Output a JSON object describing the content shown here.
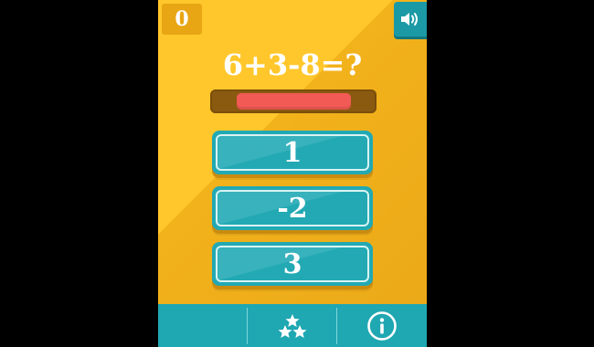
{
  "game": {
    "score": "0",
    "question": "6+3-8=?",
    "timer_remaining": 0.72,
    "answers": [
      "1",
      "-2",
      "3"
    ]
  },
  "icons": {
    "sound": "speaker-on-icon",
    "rate": "stars-icon",
    "info": "info-icon"
  },
  "colors": {
    "background": "#f2b21b",
    "button": "#22a9b4",
    "timer_fill": "#f25a55",
    "timer_track": "#8a5a10",
    "bottom_bar": "#1fa7b2"
  }
}
